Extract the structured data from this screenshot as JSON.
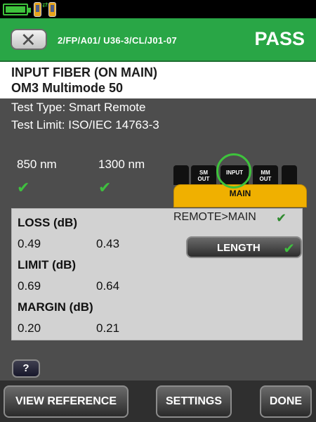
{
  "header": {
    "path": "2/FP/A01/ U36-3/CL/J01-07",
    "result": "PASS"
  },
  "info": {
    "title": "INPUT FIBER (ON MAIN)",
    "fiber_type": "OM3 Multimode 50"
  },
  "meta": {
    "test_type": "Test Type: Smart Remote",
    "test_limit": "Test Limit: ISO/IEC 14763-3"
  },
  "wavelengths": [
    "850 nm",
    "1300 nm"
  ],
  "device": {
    "ports": [
      "SM\nOUT",
      "INPUT",
      "MM\nOUT"
    ],
    "label": "MAIN",
    "highlighted_port": "INPUT"
  },
  "results": {
    "loss_label": "LOSS (dB)",
    "loss": [
      "0.49",
      "0.43"
    ],
    "limit_label": "LIMIT (dB)",
    "limit": [
      "0.69",
      "0.64"
    ],
    "margin_label": "MARGIN (dB)",
    "margin": [
      "0.20",
      "0.21"
    ],
    "direction": "REMOTE>MAIN"
  },
  "length_button": "LENGTH",
  "help_button": "?",
  "bottom_buttons": {
    "view_reference": "VIEW REFERENCE",
    "settings": "SETTINGS",
    "done": "DONE"
  },
  "colors": {
    "header_green": "#29a646",
    "check_green": "#3fbf3f",
    "device_yellow": "#f0b000"
  },
  "icons": {
    "battery": "battery-icon",
    "devices": "tester-devices-icon",
    "back": "close-x-icon",
    "check": "checkmark-icon"
  }
}
